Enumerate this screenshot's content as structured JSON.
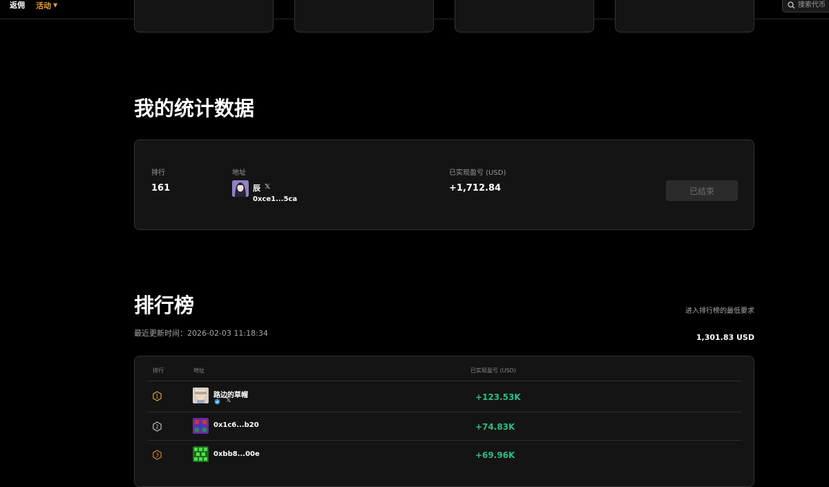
{
  "nav": {
    "rebate_label": "返佣",
    "activity_label": "活动",
    "search_placeholder": "搜索代币"
  },
  "colors": {
    "accent": "#f0a030",
    "positive": "#2ebd85",
    "card_bg": "#141414",
    "border": "#333333"
  },
  "my_stats": {
    "title": "我的统计数据",
    "rank_label": "排行",
    "rank_value": "161",
    "address_label": "地址",
    "user_name": "辰",
    "user_address": "0xce1...5ca",
    "pnl_label": "已实现盈亏 (USD)",
    "pnl_value": "+1,712.84",
    "status_button": "已结束"
  },
  "leaderboard": {
    "title": "排行榜",
    "last_updated": "最近更新时间：2026-02-03 11:18:34",
    "min_req_label": "进入排行榜的最低要求",
    "min_req_value": "1,301.83 USD",
    "headers": {
      "rank": "排行",
      "address": "地址",
      "pnl": "已实现盈亏 (USD)"
    },
    "rows": [
      {
        "rank": "1",
        "name": "路边的草帽",
        "pnl": "+123.53K",
        "verified": true,
        "has_x": true
      },
      {
        "rank": "2",
        "name": "0x1c6...b20",
        "pnl": "+74.83K",
        "verified": false,
        "has_x": false
      },
      {
        "rank": "3",
        "name": "0xbb8...00e",
        "pnl": "+69.96K",
        "verified": false,
        "has_x": false
      }
    ]
  }
}
